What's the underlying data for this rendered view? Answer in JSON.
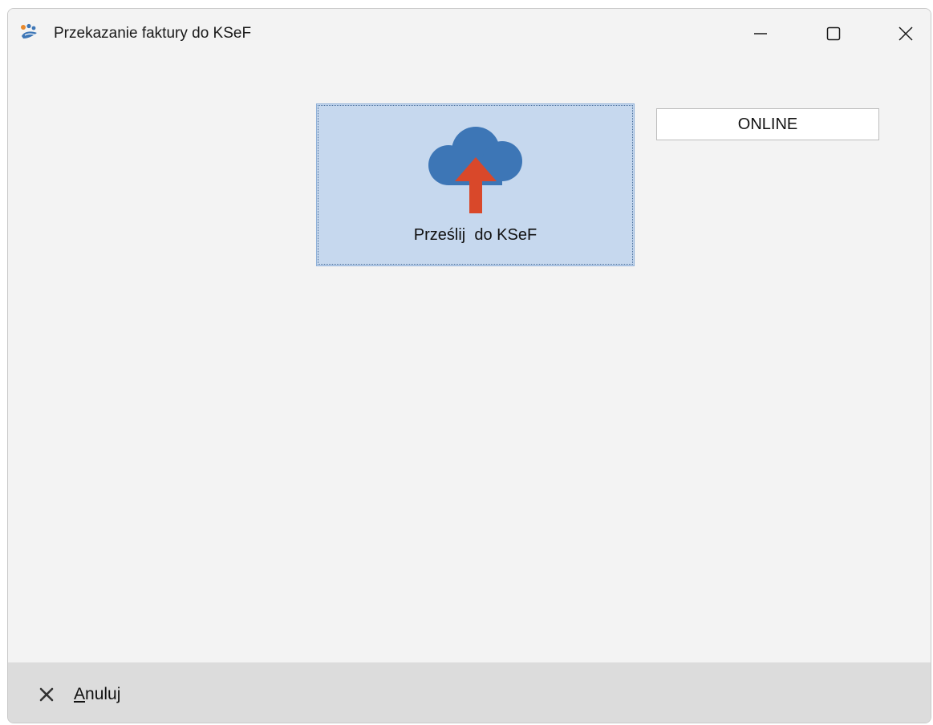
{
  "window": {
    "title": "Przekazanie faktury do KSeF",
    "controls": {
      "minimize": "minimize-icon",
      "maximize": "maximize-icon",
      "close": "close-icon"
    }
  },
  "main": {
    "send_button": {
      "label": "Prześlij  do KSeF",
      "icon": "cloud-upload-icon",
      "colors": {
        "cloud": "#3d76b6",
        "arrow": "#d9482a",
        "background": "#c6d8ee"
      }
    },
    "status": {
      "value": "ONLINE"
    }
  },
  "footer": {
    "cancel": {
      "mnemonic": "A",
      "rest": "nuluj",
      "icon": "x-icon"
    }
  }
}
